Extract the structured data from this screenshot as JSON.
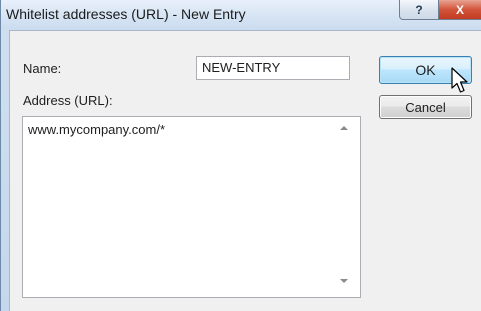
{
  "window": {
    "title": "Whitelist addresses (URL) - New Entry",
    "help_glyph": "?",
    "close_glyph": "X"
  },
  "form": {
    "name_label": "Name:",
    "name_value": "NEW-ENTRY",
    "address_label": "Address (URL):",
    "address_value": "www.mycompany.com/*"
  },
  "buttons": {
    "ok_label": "OK",
    "cancel_label": "Cancel"
  },
  "icons": {
    "cursor": "mouse-pointer-icon",
    "scroll_up": "scroll-up-arrow-icon",
    "scroll_down": "scroll-down-arrow-icon"
  },
  "colors": {
    "ok_border": "#3c7fb1",
    "close_button": "#c23b22",
    "dialog_background": "#f0f0f0"
  }
}
